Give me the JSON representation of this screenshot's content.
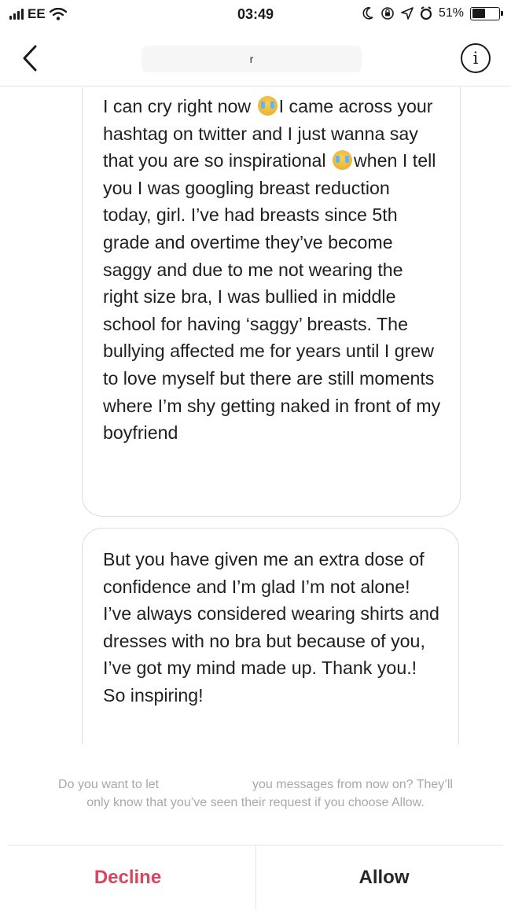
{
  "status_bar": {
    "carrier": "EE",
    "time": "03:49",
    "battery_percent": "51%",
    "battery_level": 0.51
  },
  "nav": {
    "back_icon": "chevron-left-icon",
    "title": "r",
    "info_icon": "info-icon",
    "info_label": "i"
  },
  "messages": [
    {
      "parts": [
        "I can cry right now ",
        "I came across your hashtag on twitter and I just wanna say that you are so inspirational ",
        "when I tell you I was googling breast reduction today, girl. I’ve had breasts since 5th grade and overtime they’ve become saggy and due to me not wearing the right size bra, I was bullied in middle school for having ‘saggy’ breasts. The bullying affected me for years until I grew to love myself but there are still moments where I’m shy getting naked in front of my boyfriend"
      ],
      "emoji": "crying-face-emoji"
    },
    {
      "text": "But you have given me an extra dose of confidence and I’m glad I’m not alone! I’ve always considered wearing shirts and dresses with no bra but because of you, I’ve got my mind made up. Thank you.! So inspiring!"
    }
  ],
  "request": {
    "prompt_before": "Do you want to let ",
    "prompt_after": " you messages from now on? They’ll",
    "prompt_line2": "only know that you’ve seen their request if you choose Allow.",
    "decline_label": "Decline",
    "allow_label": "Allow",
    "decline_color": "#d9455f"
  }
}
